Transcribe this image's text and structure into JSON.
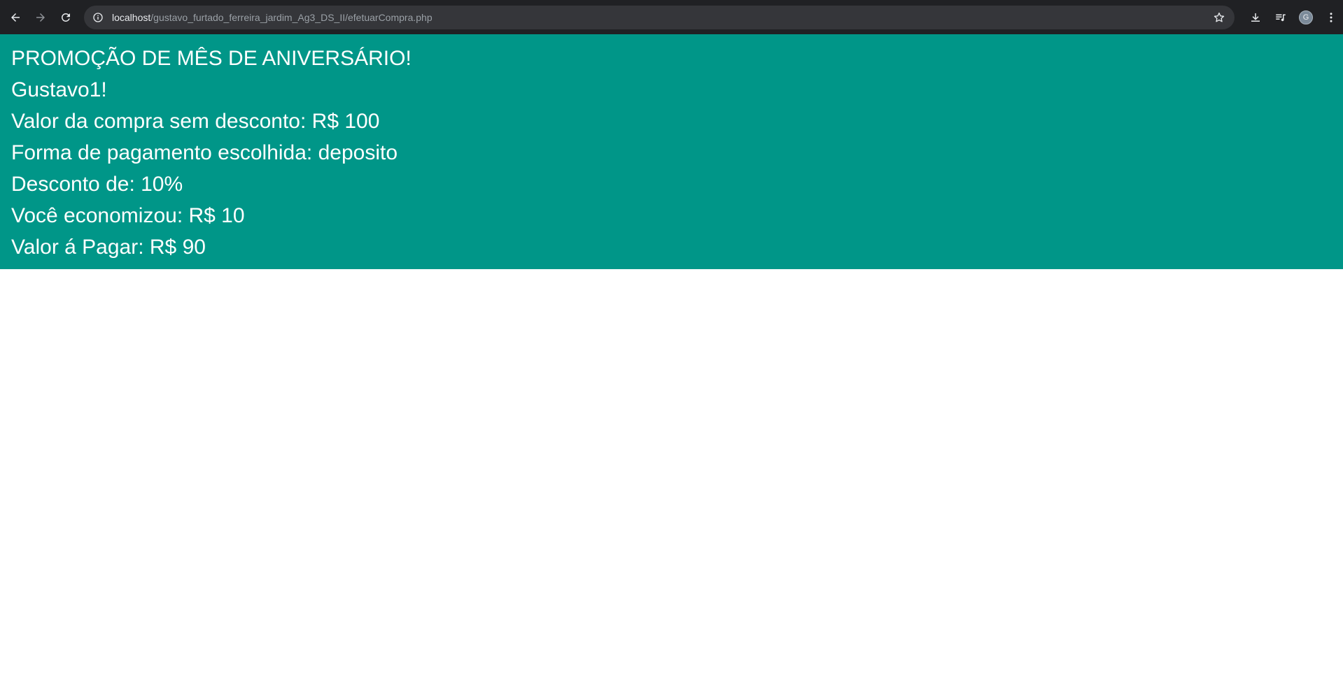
{
  "browser": {
    "url_host": "localhost",
    "url_path": "/gustavo_furtado_ferreira_jardim_Ag3_DS_II/efetuarCompra.php",
    "avatar_initial": "G",
    "icons": {
      "back": "arrow-left-icon",
      "forward": "arrow-right-icon",
      "reload": "reload-icon",
      "site_info": "info-circle-icon",
      "bookmark": "star-icon",
      "download": "download-icon",
      "media": "playlist-icon",
      "menu": "kebab-menu-icon"
    },
    "colors": {
      "toolbar_bg": "#202124",
      "omnibox_bg": "#35363a"
    }
  },
  "page": {
    "background": "#009688",
    "lines": {
      "title": "PROMOÇÃO DE MÊS DE ANIVERSÁRIO!",
      "user": "Gustavo1!",
      "valor_sem_desconto": "Valor da compra sem desconto: R$ 100",
      "forma_pagamento": "Forma de pagamento escolhida: deposito",
      "desconto": "Desconto de: 10%",
      "economizou": "Você economizou: R$ 10",
      "valor_pagar": "Valor á Pagar: R$ 90"
    }
  }
}
